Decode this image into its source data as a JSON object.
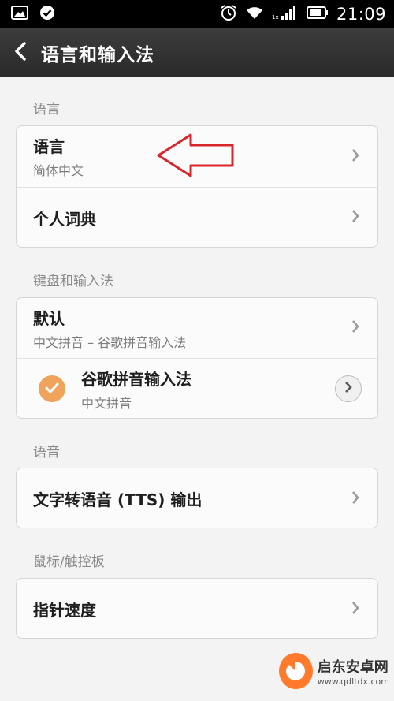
{
  "status_bar": {
    "time": "21:09",
    "icons": [
      "image-icon",
      "check-circle-icon",
      "alarm-icon",
      "wifi-icon",
      "signal-icon",
      "battery-icon"
    ]
  },
  "header": {
    "title": "语言和输入法"
  },
  "sections": [
    {
      "header": "语言",
      "items": [
        {
          "title": "语言",
          "subtitle": "简体中文"
        },
        {
          "title": "个人词典"
        }
      ]
    },
    {
      "header": "键盘和输入法",
      "items": [
        {
          "title": "默认",
          "subtitle": "中文拼音 – 谷歌拼音输入法"
        },
        {
          "title": "谷歌拼音输入法",
          "subtitle": "中文拼音"
        }
      ]
    },
    {
      "header": "语音",
      "items": [
        {
          "title": "文字转语音 (TTS) 输出"
        }
      ]
    },
    {
      "header": "鼠标/触控板",
      "items": [
        {
          "title": "指针速度"
        }
      ]
    }
  ],
  "watermark": {
    "name": "启东安卓网",
    "url": "www.qdltdx.com"
  },
  "colors": {
    "accent_check": "#f0a35a",
    "annotation_arrow": "#d9262b",
    "title_bar": "#333333",
    "background": "#f3f3f3"
  }
}
